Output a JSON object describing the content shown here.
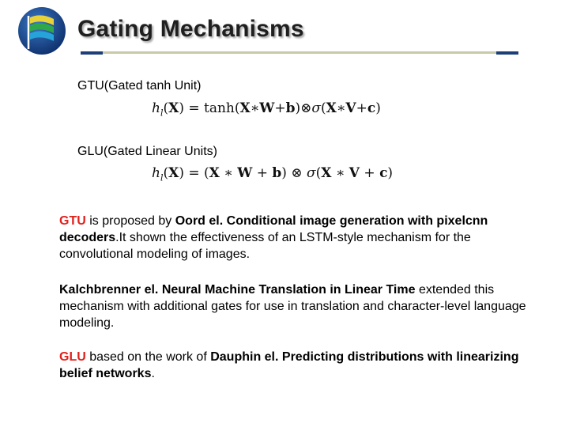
{
  "slide": {
    "title": "Gating Mechanisms"
  },
  "gtu": {
    "label": "GTU(Gated tanh Unit)",
    "formula": "h_l(X) = tanh(X*W+b)⊗σ(X*V+c)"
  },
  "glu": {
    "label": "GLU(Gated Linear Units)",
    "formula": "h_l(X) = (X * W + b) ⊗ σ(X * V + c)"
  },
  "paragraph1": {
    "term": "GTU",
    "text_a": " is proposed by ",
    "ref": "Oord el. Conditional image generation with pixelcnn decoders",
    "text_b": ".It shown the effectiveness of an LSTM-style mechanism for the convolutional modeling of images."
  },
  "paragraph2": {
    "ref": "Kalchbrenner el. Neural Machine Translation in Linear Time",
    "text": " extended this mechanism with additional gates for use in translation and character-level language modeling."
  },
  "paragraph3": {
    "term": "GLU",
    "text_a": " based on the work of ",
    "ref": "Dauphin el. Predicting distributions with linearizing belief networks",
    "text_b": "."
  },
  "colors": {
    "accent_red": "#e0201b",
    "navy": "#1c3f78",
    "rule": "#c8c9a8"
  }
}
